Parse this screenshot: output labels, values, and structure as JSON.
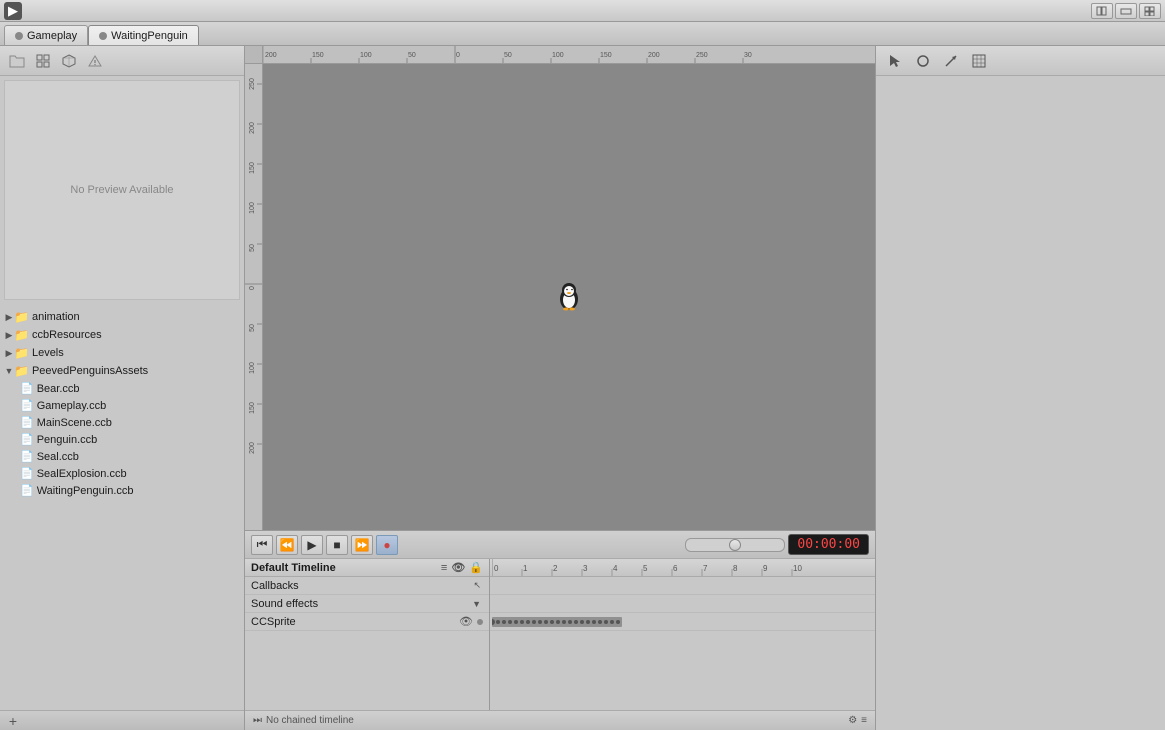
{
  "titleBar": {
    "appIcon": "▶",
    "controls": [
      "□□",
      "—□",
      "□□"
    ]
  },
  "tabs": [
    {
      "label": "Gameplay",
      "active": false,
      "iconColor": "gray"
    },
    {
      "label": "WaitingPenguin",
      "active": true,
      "iconColor": "gray"
    }
  ],
  "leftPanel": {
    "toolbarIcons": [
      "folder",
      "grid",
      "cube",
      "warning"
    ],
    "previewText": "No Preview Available",
    "fileTree": [
      {
        "type": "folder",
        "name": "animation",
        "iconColor": "red",
        "indent": 0
      },
      {
        "type": "folder",
        "name": "ccbResources",
        "iconColor": "red",
        "indent": 0
      },
      {
        "type": "folder",
        "name": "Levels",
        "iconColor": "yellow",
        "indent": 0
      },
      {
        "type": "folder",
        "name": "PeevedPenguinsAssets",
        "iconColor": "red",
        "indent": 0,
        "expanded": true
      },
      {
        "type": "file",
        "name": "Bear.ccb",
        "indent": 1
      },
      {
        "type": "file",
        "name": "Gameplay.ccb",
        "indent": 1
      },
      {
        "type": "file",
        "name": "MainScene.ccb",
        "indent": 1
      },
      {
        "type": "file",
        "name": "Penguin.ccb",
        "indent": 1
      },
      {
        "type": "file",
        "name": "Seal.ccb",
        "indent": 1
      },
      {
        "type": "file",
        "name": "SealExplosion.ccb",
        "indent": 1
      },
      {
        "type": "file",
        "name": "WaitingPenguin.ccb",
        "indent": 1
      }
    ],
    "addButton": "+"
  },
  "rightPanel": {
    "icons": [
      "cursor",
      "circle",
      "arrow",
      "grid"
    ]
  },
  "canvas": {
    "bgColor": "#888888",
    "rulerXLabels": [
      "200",
      "150",
      "100",
      "50",
      "0",
      "50",
      "100",
      "150",
      "200",
      "250",
      "30"
    ],
    "rulerYLabels": [
      "250",
      "200",
      "150",
      "100",
      "50",
      "0",
      "50",
      "100",
      "150",
      "200"
    ]
  },
  "timeline": {
    "playControls": [
      "⏮",
      "⏪",
      "▶",
      "■",
      "▶▶"
    ],
    "timecode": "00:00:00",
    "tracks": [
      {
        "name": "Default Timeline",
        "type": "header"
      },
      {
        "name": "Callbacks",
        "type": "track"
      },
      {
        "name": "Sound effects",
        "type": "track"
      },
      {
        "name": "CCSprite",
        "type": "track",
        "hasEye": true,
        "hasDot": true
      }
    ],
    "frameNums": [
      "0",
      "1",
      "2",
      "3",
      "4",
      "5",
      "6",
      "7",
      "8",
      "9",
      "10"
    ],
    "chainedLabel": "No chained timeline"
  }
}
